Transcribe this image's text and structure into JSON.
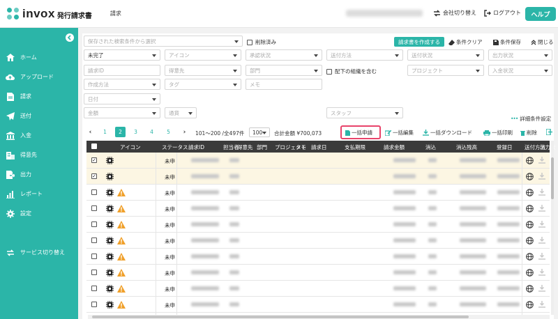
{
  "header": {
    "logo_word": "invox",
    "logo_sub": "発行請求書",
    "nav_label": "請求",
    "switch_company": "会社切り替え",
    "logout": "ログアウト",
    "help": "ヘルプ"
  },
  "sidebar": {
    "items": [
      {
        "label": "ホーム",
        "icon": "home-icon"
      },
      {
        "label": "アップロード",
        "icon": "cloud-upload-icon"
      },
      {
        "label": "請求",
        "icon": "document-icon"
      },
      {
        "label": "送付",
        "icon": "send-icon"
      },
      {
        "label": "入金",
        "icon": "bank-icon"
      },
      {
        "label": "得意先",
        "icon": "building-icon"
      },
      {
        "label": "出力",
        "icon": "export-icon"
      },
      {
        "label": "レポート",
        "icon": "chart-icon"
      },
      {
        "label": "設定",
        "icon": "gear-icon"
      }
    ],
    "switch_service": "サービス切り替え"
  },
  "filters": {
    "saved_conditions_placeholder": "保存された検索条件から選択",
    "include_deleted": "削除済み",
    "create_invoice": "請求書を作成する",
    "clear_conditions": "条件クリア",
    "save_conditions": "条件保存",
    "close": "閉じる",
    "status_value": "未完了",
    "icon_placeholder": "アイコン",
    "approval_status": "承認状況",
    "send_method": "送付方法",
    "send_status": "送付状況",
    "output_status": "出力状況",
    "invoice_id": "請求ID",
    "customer": "得意先",
    "department": "部門",
    "include_sub_org": "配下の組織を含む",
    "project": "プロジェクト",
    "payment_status": "入金状況",
    "creation_method": "作成方法",
    "tag": "タグ",
    "memo": "メモ",
    "date": "日付",
    "amount": "金額",
    "currency": "通貨",
    "staff": "スタッフ",
    "detail_settings": "詳細条件設定"
  },
  "pagination": {
    "pages": [
      "1",
      "2",
      "3",
      "4",
      "5"
    ],
    "current": "2",
    "range_text": "101〜200 /全497件",
    "per_page": "100",
    "total_label": "合計金額",
    "total_value": "¥700,073"
  },
  "bulk_actions": {
    "apply": "一括申請",
    "edit": "一括編集",
    "download": "一括ダウンロード",
    "print": "一括印刷",
    "delete": "削除"
  },
  "table": {
    "headers": [
      "アイコン",
      "ステータス",
      "請求ID",
      "担当者",
      "得意先",
      "部門",
      "プロジェクト",
      "メモ",
      "請求日",
      "支払期限",
      "請求金額",
      "消込",
      "消込残高",
      "登録日",
      "送付方法",
      "出力状"
    ],
    "rows": [
      {
        "status": "未申",
        "checked": true,
        "warning": false
      },
      {
        "status": "未申",
        "checked": true,
        "warning": false
      },
      {
        "status": "未申",
        "checked": false,
        "warning": true
      },
      {
        "status": "未申",
        "checked": false,
        "warning": true
      },
      {
        "status": "未申",
        "checked": false,
        "warning": true
      },
      {
        "status": "未申",
        "checked": false,
        "warning": true
      },
      {
        "status": "未申",
        "checked": false,
        "warning": true
      },
      {
        "status": "未申",
        "checked": false,
        "warning": true
      },
      {
        "status": "未申",
        "checked": false,
        "warning": true
      },
      {
        "status": "未申",
        "checked": false,
        "warning": true
      },
      {
        "status": "未申",
        "checked": false,
        "warning": true
      }
    ]
  },
  "colors": {
    "brand": "#2bb5a8",
    "header_dark": "#3b3b3b",
    "selected_row": "#fcf6e3",
    "highlight": "#e8436a",
    "warning": "#f0a02a"
  }
}
